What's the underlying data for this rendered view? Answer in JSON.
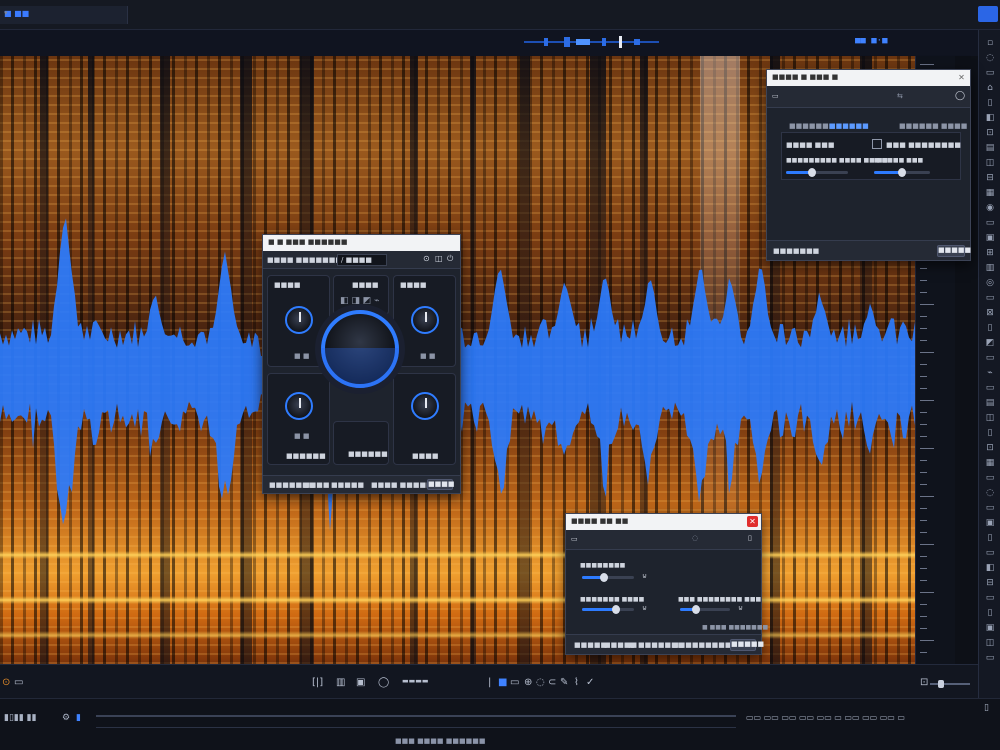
{
  "app": {
    "tab_label": "■ ■■",
    "time_readout": "■■ ■·■",
    "accent": "#2f7cff",
    "waveform_color": "#2b7cff"
  },
  "module_window": {
    "title": "■ ■ ■■■ ■■■■■■",
    "preset_label": "■■■■ ■■■■■■■",
    "preset_value": "/ ■■■■",
    "cells": [
      {
        "label": "■■■■",
        "value": "■ ■"
      },
      {
        "label": "■■■■",
        "value": ""
      },
      {
        "label": "■■■■",
        "value": "■ ■"
      },
      {
        "label": "■■■■■■",
        "value": "■ ■"
      },
      {
        "label": "",
        "value": "■ ■"
      },
      {
        "label": "■■■■",
        "value": ""
      }
    ],
    "footer": [
      "■■■■■■■",
      "■■■■",
      "■■■■■",
      "■■■■ ■■■■■■■■",
      "■■■■"
    ]
  },
  "top_right_window": {
    "title": "■■■■ ■ ■■■ ■",
    "tabs": [
      "■■■■■■■",
      "■■■■■■",
      "■■■■■■ ■■■■"
    ],
    "field_label": "■■■■ ■■■",
    "checkbox_label": "■■■ ■■■■■■■■",
    "slider1_label": "■■■■■■■■■ ■■■■ ■■ ■■",
    "slider2_label": "■ ■■■■ ■■■",
    "footer_label": "■■■■■■■",
    "footer_button": "■■■■■"
  },
  "bottom_window": {
    "title": "■■■■ ■■ ■■",
    "rows": [
      {
        "label": "■■■■■■■■",
        "value": 0.45
      },
      {
        "label": "■■■■■■■ ■■■■",
        "value": 0.65
      },
      {
        "label": "■■■ ■■■■■■■■ ■■■",
        "value": 0.3
      }
    ],
    "right_text": "■ ■■■ ■■■■■■■",
    "footer": [
      "■■■■■",
      "■■■■■",
      "■",
      "■■■■■■■",
      "■■■■■■■■■■■■"
    ],
    "button": "■■■■■"
  },
  "transport": {
    "icons": [
      "loop-icon",
      "record-icon",
      "play-icon",
      "stop-icon",
      "zoom-in-icon",
      "zoom-out-icon",
      "pencil-icon",
      "select-icon"
    ],
    "zoom_level": 0.2
  },
  "bottombar": {
    "link_text": "■■■ ■■■■ ■■■■■■"
  }
}
